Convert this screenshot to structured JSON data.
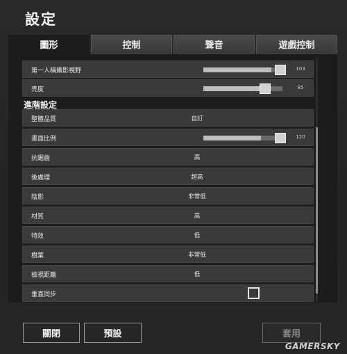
{
  "window": {
    "title": "設定"
  },
  "tabs": [
    {
      "label": "圖形",
      "active": true
    },
    {
      "label": "控制"
    },
    {
      "label": "聲音"
    },
    {
      "label": "遊戲控制"
    }
  ],
  "basic": {
    "fov": {
      "label": "第一人稱攝影視野",
      "value": "103",
      "level": 0.86
    },
    "brightness": {
      "label": "亮度",
      "value": "85",
      "level": 0.78
    }
  },
  "advanced": {
    "header": "進階設定",
    "overall_quality": {
      "label": "整體品質",
      "value": "自訂"
    },
    "screen_scale": {
      "label": "畫面比例",
      "value": "120",
      "level": 0.73
    },
    "antialiasing": {
      "label": "抗鋸齒",
      "value": "高"
    },
    "post_processing": {
      "label": "後處理",
      "value": "超高"
    },
    "shadows": {
      "label": "陰影",
      "value": "非常低"
    },
    "textures": {
      "label": "材質",
      "value": "高"
    },
    "effects": {
      "label": "特效",
      "value": "低"
    },
    "foliage": {
      "label": "樹葉",
      "value": "非常低"
    },
    "view_distance": {
      "label": "檢視距離",
      "value": "低"
    },
    "vsync": {
      "label": "垂直同步",
      "checked": false
    }
  },
  "buttons": {
    "close": "關閉",
    "default": "預設",
    "apply": "套用"
  },
  "watermark": "GAMERSKY",
  "colors": {
    "row_bg": "#3a3a3a",
    "panel_bg": "#1c1c1c",
    "slider_knob": "#d2d2d2"
  }
}
